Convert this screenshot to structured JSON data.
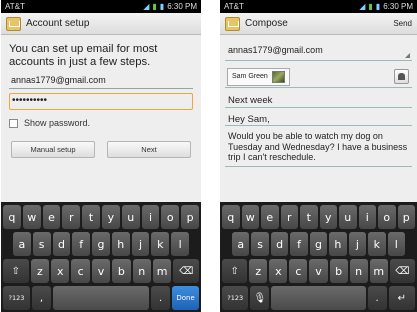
{
  "left": {
    "status": {
      "carrier": "AT&T",
      "time": "6:30 PM"
    },
    "title": "Account setup",
    "intro": "You can set up email for most accounts in just a few steps.",
    "email_value": "annas1779@gmail.com",
    "password_value": "••••••••••",
    "show_password_label": "Show password.",
    "manual_setup_label": "Manual setup",
    "next_label": "Next",
    "keyboard": {
      "row1": [
        "q",
        "w",
        "e",
        "r",
        "t",
        "y",
        "u",
        "i",
        "o",
        "p"
      ],
      "row2": [
        "a",
        "s",
        "d",
        "f",
        "g",
        "h",
        "j",
        "k",
        "l"
      ],
      "row3": [
        "z",
        "x",
        "c",
        "v",
        "b",
        "n",
        "m"
      ],
      "shift": "⇧",
      "delete": "⌫",
      "mode": "?123",
      "comma": ",",
      "period": ".",
      "action": "Done"
    }
  },
  "right": {
    "status": {
      "carrier": "AT&T",
      "time": "6:30 PM"
    },
    "title": "Compose",
    "send_label": "Send",
    "from": "annas1779@gmail.com",
    "to_chip": "Sam Green",
    "subject": "Next week",
    "greeting": "Hey Sam,",
    "body": "Would you be able to watch my dog on Tuesday and Wednesday? I have a business trip I can't reschedule.",
    "keyboard": {
      "row1": [
        "q",
        "w",
        "e",
        "r",
        "t",
        "y",
        "u",
        "i",
        "o",
        "p"
      ],
      "row2": [
        "a",
        "s",
        "d",
        "f",
        "g",
        "h",
        "j",
        "k",
        "l"
      ],
      "row3": [
        "z",
        "x",
        "c",
        "v",
        "b",
        "n",
        "m"
      ],
      "shift": "⇧",
      "delete": "⌫",
      "mode": "?123",
      "mic": "🎙",
      "period": ".",
      "enter": "↵"
    }
  },
  "icons": [
    "wifi-icon",
    "signal-icon",
    "battery-icon",
    "email-app-icon",
    "contact-picker-icon"
  ]
}
